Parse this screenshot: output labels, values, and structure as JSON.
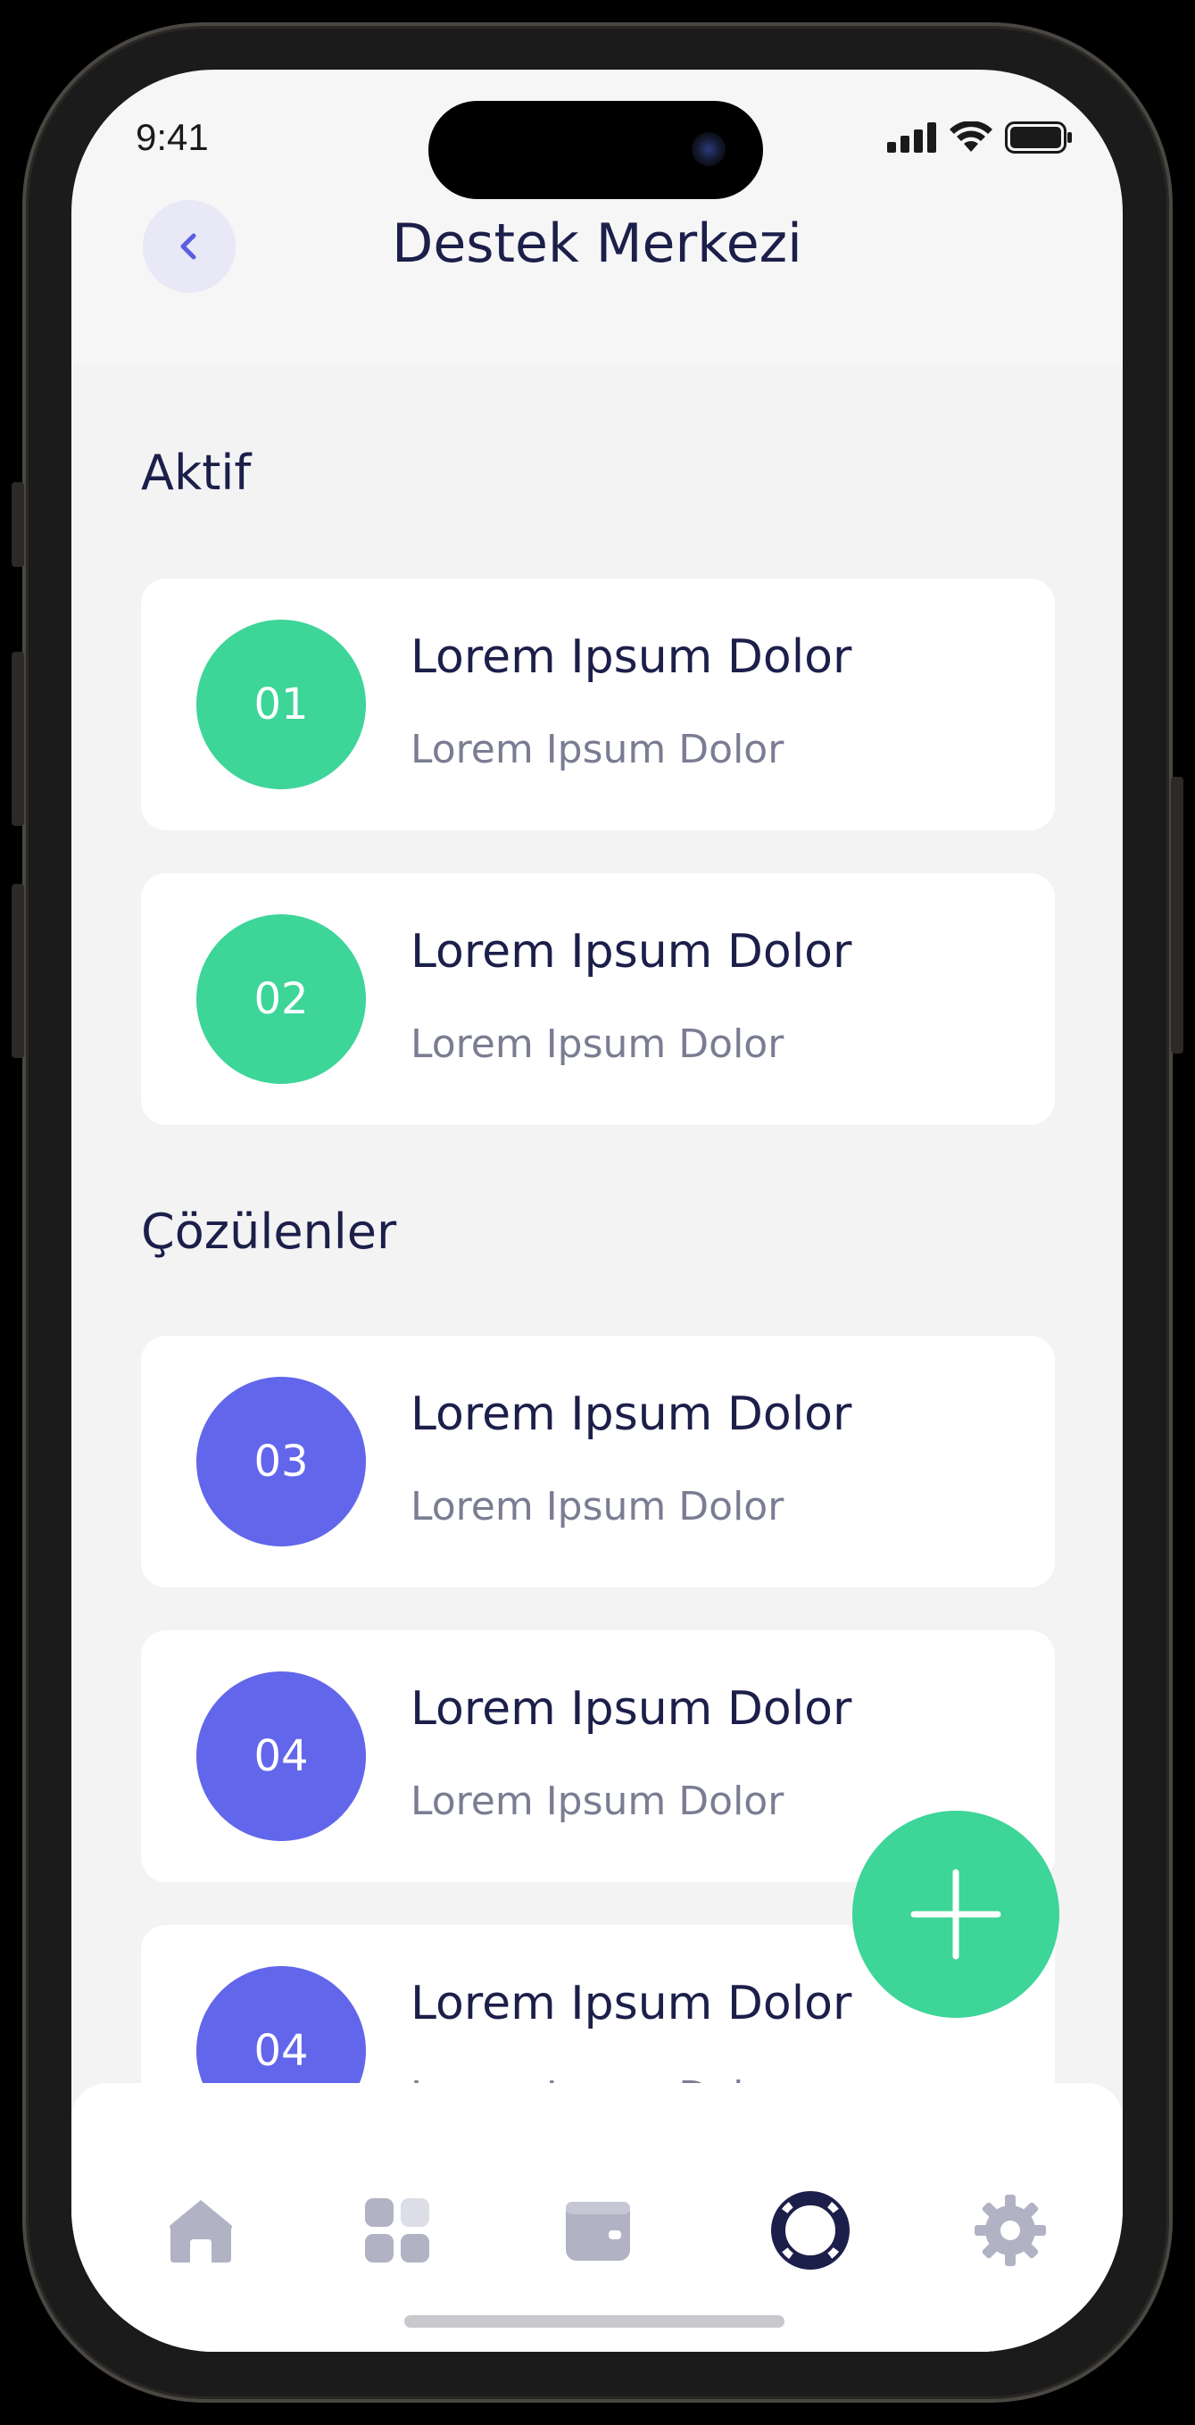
{
  "status_bar": {
    "time": "9:41"
  },
  "header": {
    "title": "Destek Merkezi"
  },
  "sections": [
    {
      "title": "Aktif",
      "items": [
        {
          "number": "01",
          "title": "Lorem Ipsum Dolor",
          "subtitle": "Lorem Ipsum Dolor"
        },
        {
          "number": "02",
          "title": "Lorem Ipsum Dolor",
          "subtitle": "Lorem Ipsum Dolor"
        }
      ]
    },
    {
      "title": "Çözülenler",
      "items": [
        {
          "number": "03",
          "title": "Lorem Ipsum Dolor",
          "subtitle": "Lorem Ipsum Dolor"
        },
        {
          "number": "04",
          "title": "Lorem Ipsum Dolor",
          "subtitle": "Lorem Ipsum Dolor"
        },
        {
          "number": "04",
          "title": "Lorem Ipsum Dolor",
          "subtitle": "Lorem Ipsum Dolor"
        }
      ]
    }
  ],
  "tab_bar": {
    "items": [
      {
        "icon": "home-icon",
        "active": false
      },
      {
        "icon": "grid-icon",
        "active": false
      },
      {
        "icon": "wallet-icon",
        "active": false
      },
      {
        "icon": "lifebuoy-icon",
        "active": true
      },
      {
        "icon": "gear-icon",
        "active": false
      }
    ]
  },
  "colors": {
    "accent_green": "#3dd598",
    "accent_purple": "#6266ea",
    "title_navy": "#1c1f4a",
    "inactive_icon": "#b1b3c4"
  }
}
